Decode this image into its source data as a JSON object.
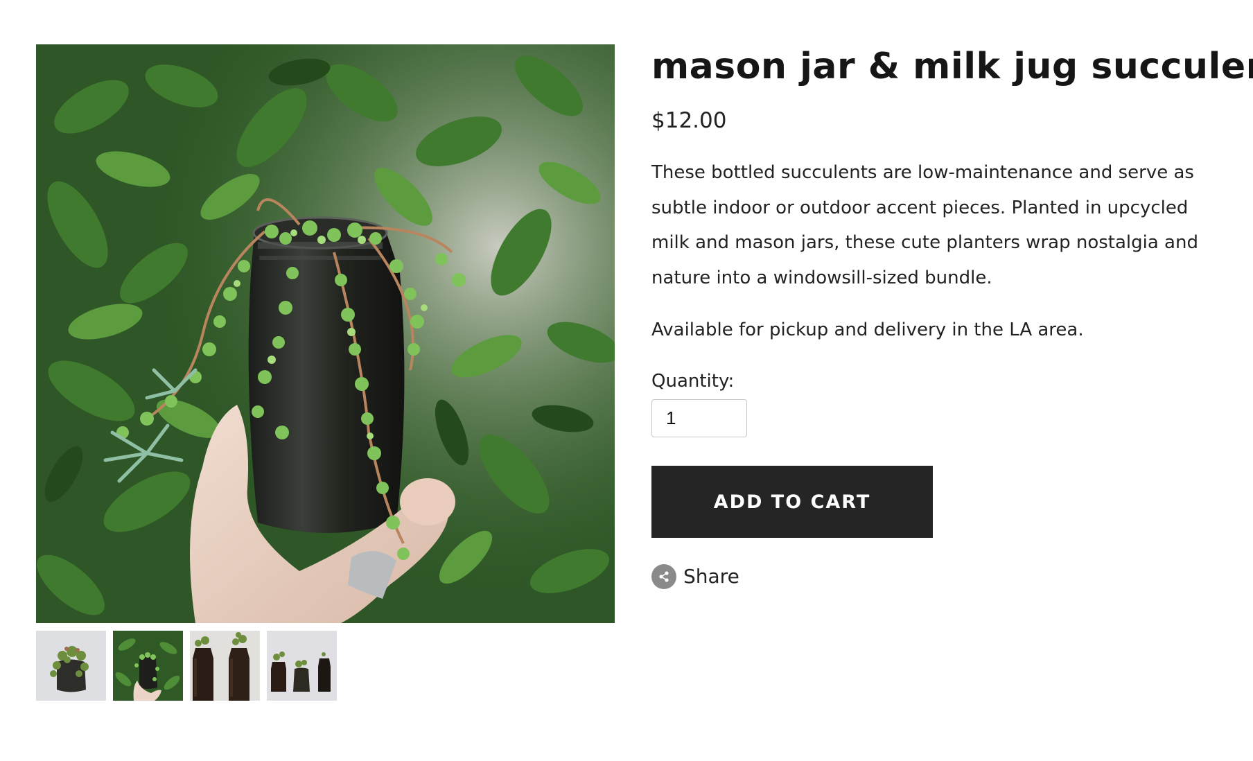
{
  "product": {
    "title": "mason jar & milk jug succulents",
    "price": "$12.00",
    "description": "These bottled succulents are low-maintenance and serve as subtle indoor or outdoor accent pieces. Planted in upcycled milk and mason jars, these cute planters wrap nostalgia and nature into a windowsill-sized bundle.",
    "availability": "Available for pickup and delivery in the LA area.",
    "quantity_label": "Quantity:",
    "quantity_value": "1",
    "add_to_cart_label": "ADD TO CART",
    "share_label": "Share"
  },
  "gallery": {
    "thumbnails": [
      "thumbnail-1",
      "thumbnail-2",
      "thumbnail-3",
      "thumbnail-4"
    ]
  },
  "icons": {
    "share": "share-icon"
  },
  "colors": {
    "button_bg": "#252525",
    "button_text": "#ffffff",
    "share_icon_bg": "#8a8a8a"
  }
}
